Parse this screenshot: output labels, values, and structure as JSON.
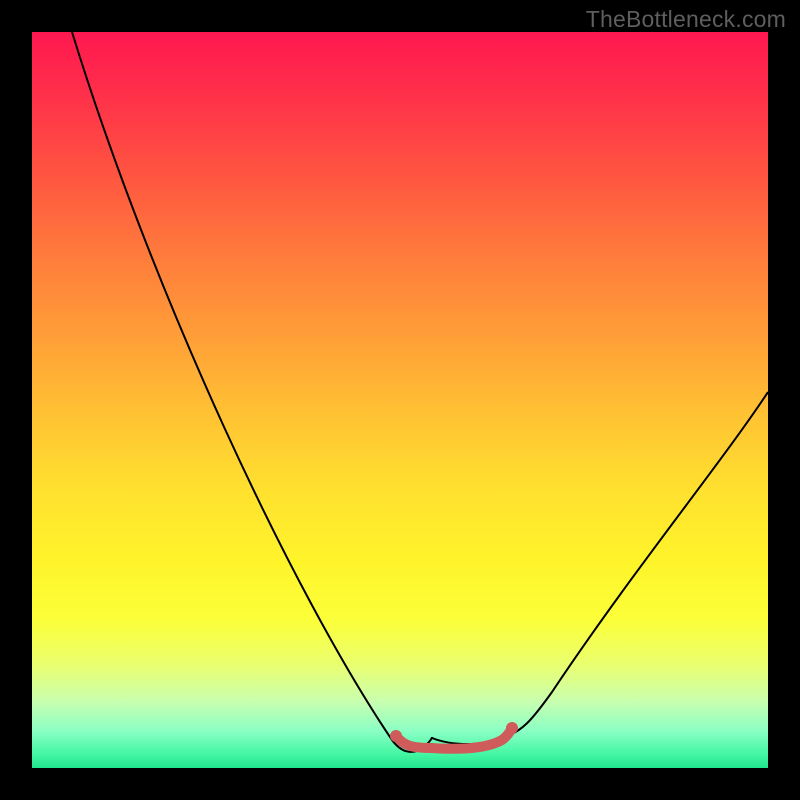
{
  "watermark": "TheBottleneck.com",
  "chart_data": {
    "type": "line",
    "title": "",
    "xlabel": "",
    "ylabel": "",
    "xlim": [
      0,
      100
    ],
    "ylim": [
      0,
      100
    ],
    "series": [
      {
        "name": "bottleneck-curve",
        "x": [
          5,
          15,
          25,
          35,
          45,
          50,
          55,
          58,
          62,
          65,
          70,
          80,
          90,
          100
        ],
        "y": [
          100,
          72,
          48,
          28,
          12,
          4,
          1,
          0,
          0,
          1,
          6,
          20,
          38,
          52
        ]
      }
    ],
    "annotations": [
      {
        "name": "optimal-range-highlight",
        "x_start": 50,
        "x_end": 65,
        "y": 0,
        "color": "#cf5b5b"
      }
    ],
    "background_gradient": {
      "direction": "vertical",
      "stops": [
        {
          "pos": 0.0,
          "color": "#ff1850"
        },
        {
          "pos": 0.3,
          "color": "#ff7a3c"
        },
        {
          "pos": 0.62,
          "color": "#ffe02f"
        },
        {
          "pos": 0.86,
          "color": "#eaff70"
        },
        {
          "pos": 1.0,
          "color": "#20e68c"
        }
      ]
    }
  }
}
